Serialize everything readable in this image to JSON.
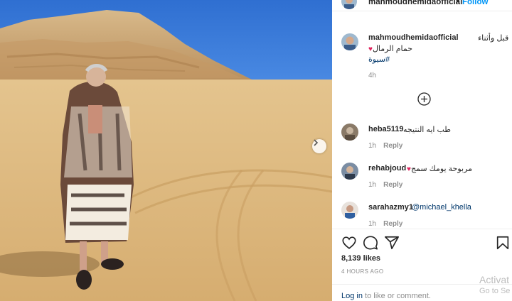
{
  "post": {
    "username": "mahmoudhemidaofficial",
    "header_dot": "•",
    "follow_label": "Follow",
    "caption_line1": "قبل وأثناء",
    "caption_line2": "حمام الرمال",
    "caption_heart": "♥",
    "caption_hashtag": "#سيوة",
    "caption_time": "4h",
    "likes": "8,139 likes",
    "posted_ago": "4 HOURS AGO"
  },
  "comments": [
    {
      "username": "heba5119",
      "text": "طب ايه النتيجه",
      "time": "1h",
      "reply_label": "Reply"
    },
    {
      "username": "rehabjoud",
      "text": "مربوحة يومك سمج",
      "heart": "♥",
      "time": "1h",
      "reply_label": "Reply"
    },
    {
      "username": "sarahazmy1",
      "text": "@michael_khella",
      "time": "1h",
      "reply_label": "Reply"
    }
  ],
  "footer": {
    "login_link": "Log in",
    "login_rest": " to like or comment."
  },
  "watermark": {
    "line1": "Activat",
    "line2": "Go to Se"
  },
  "icons": {
    "like": "heart-outline-icon",
    "comment": "comment-bubble-icon",
    "share": "paper-plane-icon",
    "save": "bookmark-icon",
    "load_more": "plus-circle-icon",
    "next": "chevron-right-icon"
  },
  "colors": {
    "follow": "#0095f6",
    "link": "#00376b",
    "muted": "#8e8e8e",
    "text": "#262626",
    "heart": "#e0245e"
  }
}
